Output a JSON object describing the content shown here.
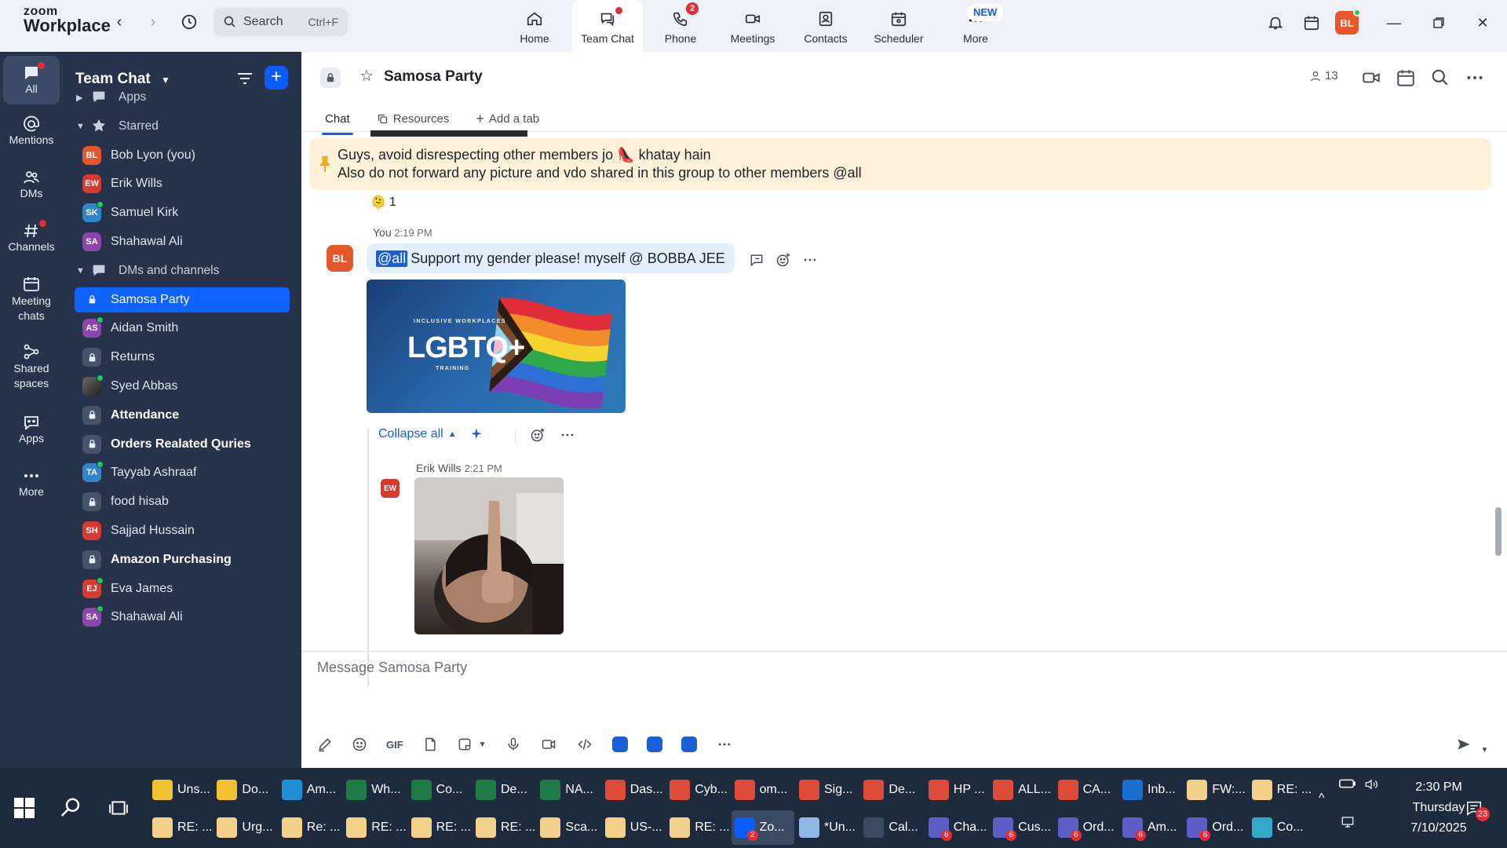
{
  "app": {
    "logo_line1": "zoom",
    "logo_line2": "Workplace"
  },
  "colors": {
    "accent": "#0b5cff",
    "rail_bg": "#26334a",
    "pinned_bg": "#fdf0d8",
    "bubble_bg": "#e2effd",
    "badge_red": "#e12d39"
  },
  "header": {
    "search_label": "Search",
    "search_hint": "Ctrl+F",
    "tabs": [
      {
        "label": "Home",
        "icon": "home-icon"
      },
      {
        "label": "Team Chat",
        "icon": "team-chat-icon",
        "active": true
      },
      {
        "label": "Phone",
        "icon": "phone-icon",
        "badge": "2"
      },
      {
        "label": "Meetings",
        "icon": "video-camera-icon"
      },
      {
        "label": "Contacts",
        "icon": "contacts-icon"
      },
      {
        "label": "Scheduler",
        "icon": "calendar-icon"
      },
      {
        "label": "More",
        "icon": "more-icon"
      }
    ],
    "new_badge": "NEW",
    "profile_initials": "BL"
  },
  "rail": [
    {
      "label": "All",
      "icon": "chat-bubble-icon",
      "active": true
    },
    {
      "label": "Mentions",
      "icon": "at-sign-icon"
    },
    {
      "label": "DMs",
      "icon": "people-icon"
    },
    {
      "label": "Channels",
      "icon": "hashtag-icon"
    },
    {
      "label": "Meeting chats",
      "line1": "Meeting",
      "line2": "chats",
      "icon": "calendar-icon"
    },
    {
      "label": "Shared spaces",
      "line1": "Shared",
      "line2": "spaces",
      "icon": "shared-spaces-icon"
    },
    {
      "label": "Apps",
      "icon": "apps-icon"
    },
    {
      "label": "More",
      "icon": "ellipsis-icon"
    }
  ],
  "sidebar": {
    "title": "Team Chat",
    "items": [
      {
        "type": "section",
        "label": "Apps",
        "icon": "apps-icon",
        "chevron": "▶"
      },
      {
        "type": "section",
        "label": "Starred",
        "icon": "star-icon",
        "chevron": "▼"
      },
      {
        "type": "contact",
        "label": "Bob Lyon (you)",
        "initials": "BL",
        "color": "#e5572a"
      },
      {
        "type": "contact",
        "label": "Erik Wills",
        "initials": "EW",
        "color": "#d73a31"
      },
      {
        "type": "contact",
        "label": "Samuel Kirk",
        "initials": "SK",
        "color": "#2f86c9",
        "online": true
      },
      {
        "type": "contact",
        "label": "Shahawal Ali",
        "initials": "SA",
        "color": "#8e44ad"
      },
      {
        "type": "section",
        "label": "DMs and channels",
        "icon": "chat-bubble-icon",
        "chevron": "▼"
      },
      {
        "type": "channel",
        "label": "Samosa Party",
        "active": true
      },
      {
        "type": "contact",
        "label": "Aidan Smith",
        "initials": "AS",
        "color": "#8e44ad",
        "online": true
      },
      {
        "type": "channel",
        "label": "Returns"
      },
      {
        "type": "photo",
        "label": "Syed Abbas",
        "online": true
      },
      {
        "type": "channel",
        "label": "Attendance",
        "bold": true
      },
      {
        "type": "channel",
        "label": "Orders Realated Quries",
        "bold": true
      },
      {
        "type": "contact",
        "label": "Tayyab Ashraaf",
        "initials": "TA",
        "color": "#2f86c9",
        "online": true
      },
      {
        "type": "channel",
        "label": "food hisab"
      },
      {
        "type": "contact",
        "label": "Sajjad Hussain",
        "initials": "SH",
        "color": "#d73a31"
      },
      {
        "type": "channel",
        "label": "Amazon Purchasing",
        "bold": true
      },
      {
        "type": "contact",
        "label": "Eva James",
        "initials": "EJ",
        "color": "#d73a31",
        "online": true
      },
      {
        "type": "contact",
        "label": "Shahawal Ali",
        "initials": "SA",
        "color": "#8e44ad",
        "online": true
      }
    ]
  },
  "channel": {
    "title": "Samosa Party",
    "member_count": "13",
    "tabs": [
      "Chat",
      "Resources",
      "Add a tab"
    ],
    "pinned_line1": "Guys, avoid disrespecting other members jo 👠 khatay hain",
    "pinned_line2": "Also do not forward any picture and vdo shared in this group to other members @all",
    "reaction_emoji": "🫠",
    "reaction_count": "1",
    "message": {
      "author": "You",
      "time": "2:19 PM",
      "avatar": "BL",
      "mention": "@all",
      "text": "Support my gender please! myself @ BOBBA JEE",
      "image_small": "INCLUSIVE WORKPLACES",
      "image_big": "LGBTQ+",
      "image_sub": "TRAINING"
    },
    "thread": {
      "collapse_label": "Collapse all",
      "reply_author": "Erik Wills",
      "reply_time": "2:21 PM",
      "reply_avatar": "EW"
    },
    "composer_placeholder": "Message Samosa Party"
  },
  "taskbar": {
    "row1": [
      {
        "label": "Uns...",
        "color": "#f2c230"
      },
      {
        "label": "Do...",
        "color": "#f2c230"
      },
      {
        "label": "Am...",
        "color": "#1f8fd6"
      },
      {
        "label": "Wh...",
        "color": "#1e7b45"
      },
      {
        "label": "Co...",
        "color": "#1e7b45"
      },
      {
        "label": "De...",
        "color": "#1e7b45"
      },
      {
        "label": "NA...",
        "color": "#1e7b45"
      },
      {
        "label": "Das...",
        "color": "#de4b39"
      },
      {
        "label": "Cyb...",
        "color": "#de4b39"
      },
      {
        "label": "om...",
        "color": "#de4b39"
      },
      {
        "label": "Sig...",
        "color": "#de4b39"
      },
      {
        "label": "De...",
        "color": "#de4b39"
      },
      {
        "label": "HP ...",
        "color": "#de4b39"
      },
      {
        "label": "ALL...",
        "color": "#de4b39"
      },
      {
        "label": "CA...",
        "color": "#de4b39"
      },
      {
        "label": "Inb...",
        "color": "#1a6fd1"
      },
      {
        "label": "FW:...",
        "color": "#f3d18a"
      },
      {
        "label": "RE: ...",
        "color": "#f3d18a"
      }
    ],
    "row2": [
      {
        "label": "RE: ...",
        "color": "#f3d18a"
      },
      {
        "label": "Urg...",
        "color": "#f3d18a"
      },
      {
        "label": "Re: ...",
        "color": "#f3d18a"
      },
      {
        "label": "RE: ...",
        "color": "#f3d18a"
      },
      {
        "label": "RE: ...",
        "color": "#f3d18a"
      },
      {
        "label": "RE: ...",
        "color": "#f3d18a"
      },
      {
        "label": "Sca...",
        "color": "#f3d18a"
      },
      {
        "label": "US-...",
        "color": "#f3d18a"
      },
      {
        "label": "RE: ...",
        "color": "#f3d18a"
      },
      {
        "label": "Zo...",
        "color": "#0b5cff",
        "badge": "2",
        "active": true
      },
      {
        "label": "*Un...",
        "color": "#8fb7e8"
      },
      {
        "label": "Cal...",
        "color": "#3a4a63"
      },
      {
        "label": "Cha...",
        "color": "#5b5fc7",
        "badge": "6"
      },
      {
        "label": "Cus...",
        "color": "#5b5fc7",
        "badge": "6"
      },
      {
        "label": "Ord...",
        "color": "#5b5fc7",
        "badge": "6"
      },
      {
        "label": "Am...",
        "color": "#5b5fc7",
        "badge": "6"
      },
      {
        "label": "Ord...",
        "color": "#5b5fc7",
        "badge": "6"
      },
      {
        "label": "Co...",
        "color": "#35a8c9"
      }
    ],
    "time": "2:30 PM",
    "day": "Thursday",
    "date": "7/10/2025",
    "notification_count": "23"
  }
}
